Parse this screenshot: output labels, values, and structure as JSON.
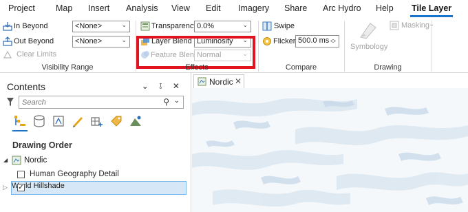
{
  "menu": {
    "tabs": [
      "Project",
      "Map",
      "Insert",
      "Analysis",
      "View",
      "Edit",
      "Imagery",
      "Share",
      "Arc Hydro",
      "Help",
      "Tile Layer"
    ]
  },
  "ribbon": {
    "visibility_range": {
      "in_beyond_label": "In Beyond",
      "in_beyond_value": "<None>",
      "out_beyond_label": "Out Beyond",
      "out_beyond_value": "<None>",
      "clear_limits_label": "Clear Limits",
      "group_label": "Visibility Range"
    },
    "effects": {
      "transparency_label": "Transparency",
      "transparency_value": "0.0%",
      "layer_blend_label": "Layer Blend",
      "layer_blend_value": "Luminosity",
      "feature_blend_label": "Feature Blend",
      "feature_blend_value": "Normal",
      "group_label": "Effects"
    },
    "compare": {
      "swipe_label": "Swipe",
      "flicker_label": "Flicker",
      "flicker_value": "500.0 ms",
      "group_label": "Compare"
    },
    "drawing": {
      "symbology_label": "Symbology",
      "masking_label": "Masking",
      "group_label": "Drawing"
    }
  },
  "contents": {
    "title": "Contents",
    "controls": "⌄ ⫱ ✕",
    "search_placeholder": "Search",
    "drawing_order_label": "Drawing Order",
    "map_name": "Nordic",
    "layers": [
      {
        "name": "Human Geography Detail",
        "checked": false
      },
      {
        "name": "World Hillshade",
        "checked": true
      }
    ]
  },
  "map": {
    "tab_label": "Nordic",
    "close_glyph": "✕"
  },
  "colors": {
    "accent": "#1a73c9",
    "highlight": "#e0141e",
    "selection": "#d6e8f7"
  }
}
